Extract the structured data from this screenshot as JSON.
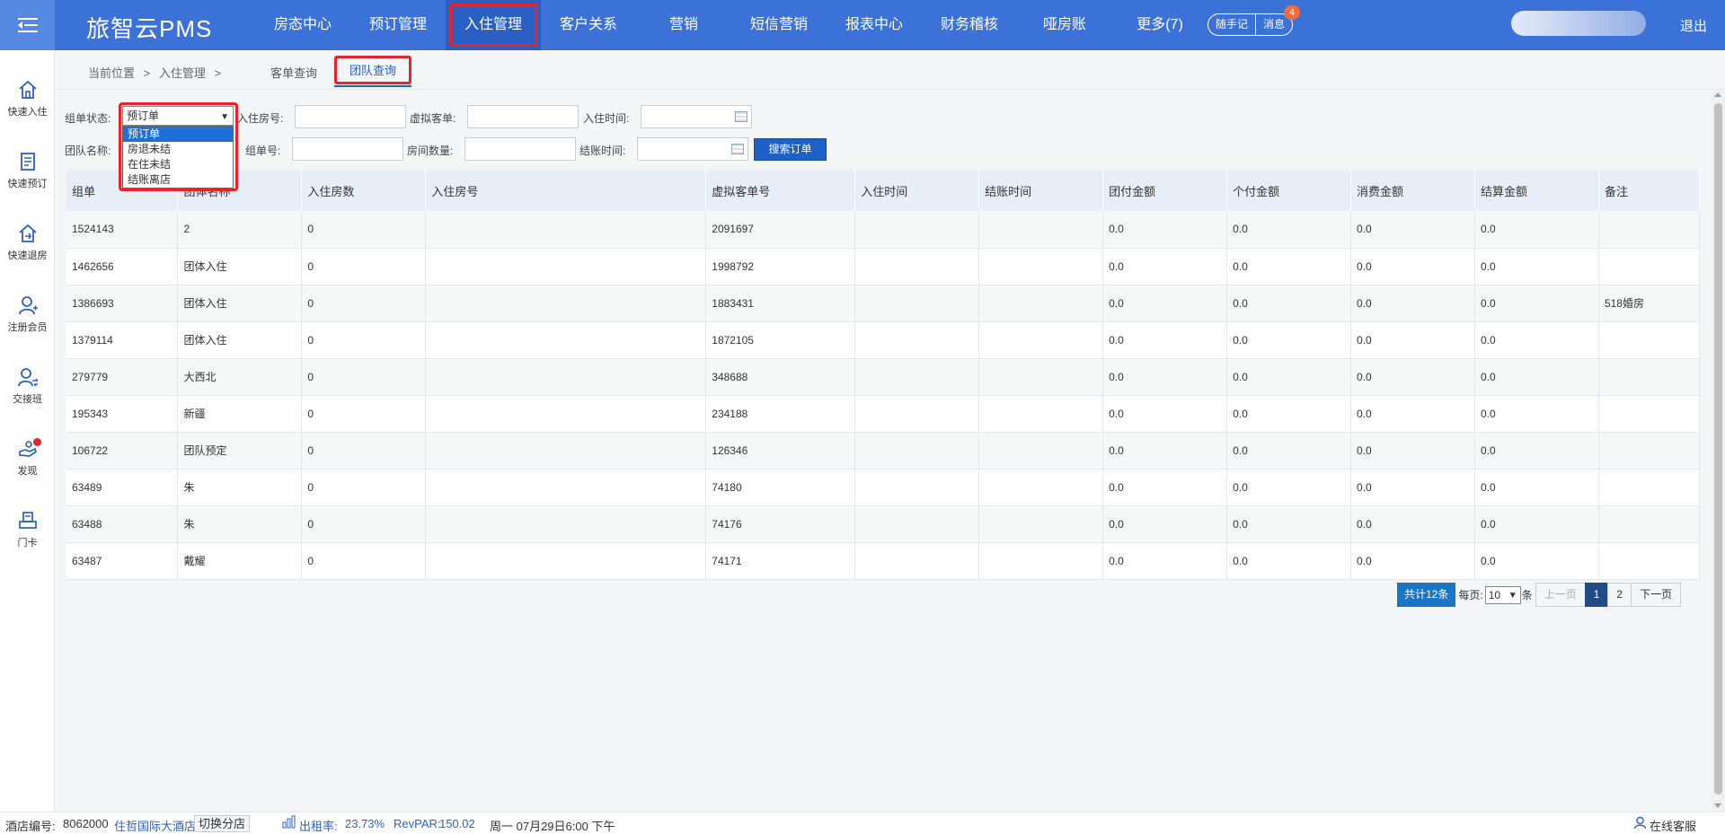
{
  "header": {
    "logo": "旅智云PMS",
    "nav": [
      "房态中心",
      "预订管理",
      "入住管理",
      "客户关系",
      "营销",
      "短信营销",
      "报表中心",
      "财务稽核",
      "哑房账",
      "更多(7)"
    ],
    "active_nav": "入住管理",
    "pill": {
      "notes": "随手记",
      "messages": "消息"
    },
    "message_count": "4",
    "logout": "退出"
  },
  "sidebar": [
    {
      "label": "快速入住",
      "icon": "home-icon"
    },
    {
      "label": "快速预订",
      "icon": "document-icon"
    },
    {
      "label": "快速退房",
      "icon": "checkout-house-icon"
    },
    {
      "label": "注册会员",
      "icon": "user-add-icon"
    },
    {
      "label": "交接班",
      "icon": "user-swap-icon"
    },
    {
      "label": "发现",
      "icon": "discover-hand-icon"
    },
    {
      "label": "门卡",
      "icon": "card-printer-icon"
    }
  ],
  "breadcrumb": {
    "position": "当前位置",
    "sep": ">",
    "section": "入住管理",
    "sep2": ">"
  },
  "tabs": [
    "客单查询",
    "团队查询"
  ],
  "filters": {
    "status_label": "组单状态:",
    "status_value": "预订单",
    "status_options": [
      "预订单",
      "房退未结",
      "在住未结",
      "结账离店"
    ],
    "room_no_label": "入住房号:",
    "virtual_label": "虚拟客单:",
    "checkin_time_label": "入住时间:",
    "team_name_label": "团队名称:",
    "group_no_label": "组单号:",
    "room_count_label": "房间数量:",
    "checkout_time_label": "结账时间:",
    "search_button": "搜索订单"
  },
  "table": {
    "columns": [
      "组单",
      "团体名称",
      "入住房数",
      "入住房号",
      "虚拟客单号",
      "入住时间",
      "结账时间",
      "团付金额",
      "个付金额",
      "消费金额",
      "结算金额",
      "备注"
    ],
    "rows": [
      [
        "1524143",
        "2",
        "0",
        "",
        "2091697",
        "",
        "",
        "0.0",
        "0.0",
        "0.0",
        "0.0",
        ""
      ],
      [
        "1462656",
        "团体入住",
        "0",
        "",
        "1998792",
        "",
        "",
        "0.0",
        "0.0",
        "0.0",
        "0.0",
        ""
      ],
      [
        "1386693",
        "团体入住",
        "0",
        "",
        "1883431",
        "",
        "",
        "0.0",
        "0.0",
        "0.0",
        "0.0",
        "518婚房"
      ],
      [
        "1379114",
        "团体入住",
        "0",
        "",
        "1872105",
        "",
        "",
        "0.0",
        "0.0",
        "0.0",
        "0.0",
        ""
      ],
      [
        "279779",
        "大西北",
        "0",
        "",
        "348688",
        "",
        "",
        "0.0",
        "0.0",
        "0.0",
        "0.0",
        ""
      ],
      [
        "195343",
        "新疆",
        "0",
        "",
        "234188",
        "",
        "",
        "0.0",
        "0.0",
        "0.0",
        "0.0",
        ""
      ],
      [
        "106722",
        "团队预定",
        "0",
        "",
        "126346",
        "",
        "",
        "0.0",
        "0.0",
        "0.0",
        "0.0",
        ""
      ],
      [
        "63489",
        "朱",
        "0",
        "",
        "74180",
        "",
        "",
        "0.0",
        "0.0",
        "0.0",
        "0.0",
        ""
      ],
      [
        "63488",
        "朱",
        "0",
        "",
        "74176",
        "",
        "",
        "0.0",
        "0.0",
        "0.0",
        "0.0",
        ""
      ],
      [
        "63487",
        "戴耀",
        "0",
        "",
        "74171",
        "",
        "",
        "0.0",
        "0.0",
        "0.0",
        "0.0",
        ""
      ]
    ]
  },
  "pagination": {
    "total": "共计12条",
    "per_page_label": "每页:",
    "per_page_value": "10",
    "per_page_unit": "条",
    "prev": "上一页",
    "pages": [
      "1",
      "2"
    ],
    "current": "1",
    "next": "下一页"
  },
  "footer": {
    "hotel_no_label": "酒店编号:",
    "hotel_no": "8062000",
    "hotel_name": "住哲国际大酒店",
    "switch": "切换分店",
    "occupancy": "出租率:",
    "occupancy_value": "23.73%",
    "revpar_label": "RevPAR:",
    "revpar_value": "150.02",
    "date": "周一 07月29日6:00 下午",
    "service": "在线客服"
  },
  "colors": {
    "primary": "#3c72d8",
    "highlight": "#e8232c",
    "button": "#1e5fc8"
  }
}
